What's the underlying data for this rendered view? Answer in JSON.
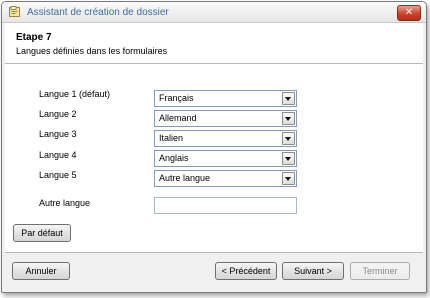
{
  "window": {
    "title": "Assistant de création de dossier",
    "close_glyph": "✕"
  },
  "header": {
    "step_title": "Etape 7",
    "step_subtitle": "Langues définies dans les formulaires"
  },
  "languages": [
    {
      "label": "Langue 1 (défaut)",
      "value": "Français"
    },
    {
      "label": "Langue 2",
      "value": "Allemand"
    },
    {
      "label": "Langue 3",
      "value": "Italien"
    },
    {
      "label": "Langue 4",
      "value": "Anglais"
    },
    {
      "label": "Langue 5",
      "value": "Autre langue"
    }
  ],
  "other_language": {
    "label": "Autre langue",
    "value": ""
  },
  "default_button": "Par défaut",
  "footer": {
    "cancel": "Annuler",
    "previous": "< Précédent",
    "next": "Suivant >",
    "finish": "Terminer"
  }
}
